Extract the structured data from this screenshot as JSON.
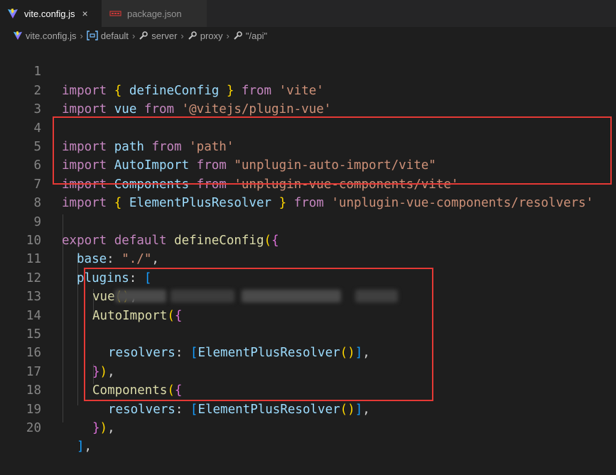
{
  "tabs": [
    {
      "label": "vite.config.js",
      "close": "×",
      "icon": "vite-icon"
    },
    {
      "label": "package.json",
      "icon": "json-icon"
    }
  ],
  "breadcrumb": {
    "items": [
      "vite.config.js",
      "default",
      "server",
      "proxy",
      "\"/api\""
    ],
    "separator": "›"
  },
  "code": {
    "line_numbers": [
      "1",
      "2",
      "3",
      "4",
      "5",
      "6",
      "7",
      "8",
      "9",
      "10",
      "11",
      "12",
      "13",
      "14",
      "15",
      "16",
      "17",
      "18",
      "19",
      "20"
    ],
    "l1": {
      "a": "import",
      "b": " ",
      "c": "{",
      "d": " defineConfig ",
      "e": "}",
      "f": " ",
      "g": "from",
      "h": " ",
      "i": "'vite'"
    },
    "l2": {
      "a": "import",
      "b": " vue ",
      "c": "from",
      "d": " ",
      "e": "'@vitejs/plugin-vue'"
    },
    "l4": {
      "a": "import",
      "b": " path ",
      "c": "from",
      "d": " ",
      "e": "'path'"
    },
    "l5": {
      "a": "import",
      "b": " AutoImport ",
      "c": "from",
      "d": " ",
      "e": "\"unplugin-auto-import/vite\""
    },
    "l6": {
      "a": "import",
      "b": " Components ",
      "c": "from",
      "d": " ",
      "e": "'unplugin-vue-components/vite'"
    },
    "l7": {
      "a": "import",
      "b": " ",
      "c": "{",
      "d": " ElementPlusResolver ",
      "e": "}",
      "f": " ",
      "g": "from",
      "h": " ",
      "i": "'unplugin-vue-components/resolvers'"
    },
    "l9": {
      "a": "export",
      "b": " ",
      "c": "default",
      "d": " ",
      "e": "defineConfig",
      "f": "(",
      "g": "{"
    },
    "l10": {
      "a": "base",
      "b": ": ",
      "c": "\"./\"",
      "d": ","
    },
    "l11": {
      "a": "plugins",
      "b": ": ",
      "c": "["
    },
    "l12": {
      "a": "vue",
      "b": "()",
      "c": ","
    },
    "l13": {
      "a": "AutoImport",
      "b": "(",
      "c": "{"
    },
    "l15": {
      "a": "resolvers",
      "b": ": ",
      "c": "[",
      "d": "ElementPlusResolver",
      "e": "()",
      "f": "]",
      "g": ","
    },
    "l16": {
      "a": "}",
      "b": ")",
      "c": ","
    },
    "l17": {
      "a": "Components",
      "b": "(",
      "c": "{"
    },
    "l18": {
      "a": "resolvers",
      "b": ": ",
      "c": "[",
      "d": "ElementPlusResolver",
      "e": "()",
      "f": "]",
      "g": ","
    },
    "l19": {
      "a": "}",
      "b": ")",
      "c": ","
    },
    "l20": {
      "a": "]",
      "b": ","
    }
  },
  "colors": {
    "highlight_box": "#e53935",
    "keyword": "#569cd6",
    "control": "#c586c0",
    "string": "#ce9178",
    "function": "#dcdcaa",
    "property": "#9cdcfe"
  }
}
